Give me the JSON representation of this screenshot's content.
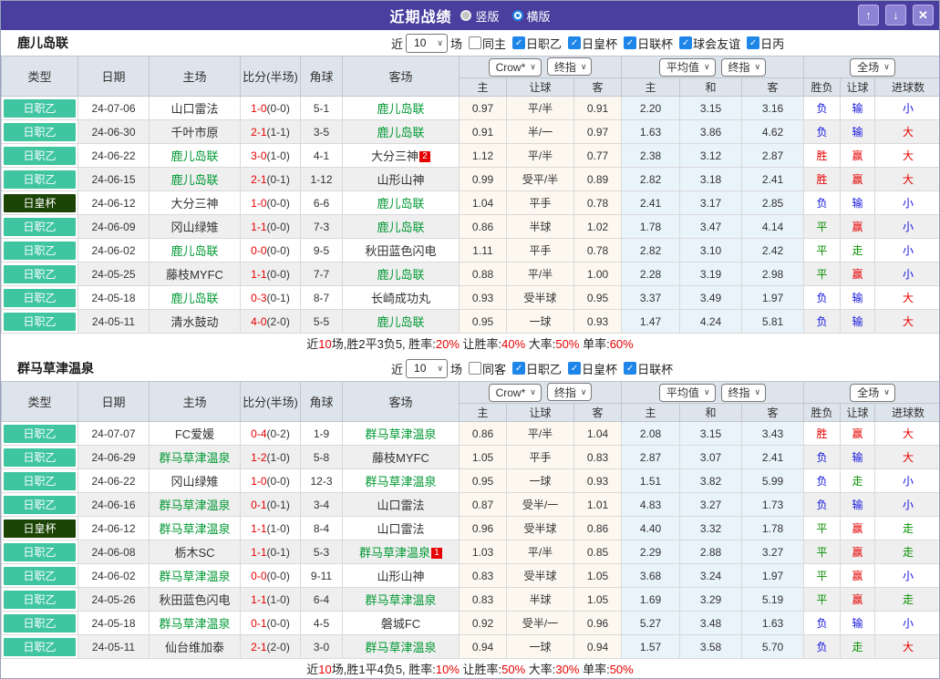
{
  "titlebar": {
    "title": "近期战绩",
    "radio_vertical": {
      "label": "竖版",
      "selected": false
    },
    "radio_horizontal": {
      "label": "横版",
      "selected": true
    },
    "up_icon": "↑",
    "down_icon": "↓",
    "close_icon": "✕"
  },
  "filter_labels": {
    "near": "近",
    "matches": "场",
    "count": "10"
  },
  "table_header": {
    "static_cols": [
      "类型",
      "日期",
      "主场",
      "比分(半场)",
      "角球",
      "客场"
    ],
    "dropdowns": {
      "bookmaker": "Crow*",
      "bookmaker_mode": "终指",
      "average": "平均值",
      "average_mode": "终指",
      "scope": "全场"
    },
    "sub_cols": [
      "主",
      "让球",
      "客",
      "主",
      "和",
      "客",
      "胜负",
      "让球",
      "进球数"
    ]
  },
  "sections": [
    {
      "team": "鹿儿岛联",
      "count": "10",
      "same_venue": {
        "label": "同主",
        "checked": false
      },
      "leagues": [
        {
          "label": "日职乙",
          "checked": true
        },
        {
          "label": "日皇杯",
          "checked": true
        },
        {
          "label": "日联杯",
          "checked": true
        },
        {
          "label": "球会友谊",
          "checked": true
        },
        {
          "label": "日丙",
          "checked": true
        }
      ],
      "rows": [
        {
          "type": "日职乙",
          "cup": false,
          "date": "24-07-06",
          "home": "山口雷法",
          "home_green": false,
          "home_badge": "",
          "score": "1-0",
          "half": "(0-0)",
          "corner": "5-1",
          "away": "鹿儿岛联",
          "away_green": true,
          "away_badge": "",
          "crow": [
            "0.97",
            "平/半",
            "0.91"
          ],
          "avg": [
            "2.20",
            "3.15",
            "3.16"
          ],
          "result": [
            [
              "负",
              "blue"
            ],
            [
              "输",
              "blue"
            ],
            [
              "小",
              "blue"
            ]
          ]
        },
        {
          "type": "日职乙",
          "cup": false,
          "date": "24-06-30",
          "home": "千叶市原",
          "home_green": false,
          "home_badge": "",
          "score": "2-1",
          "half": "(1-1)",
          "corner": "3-5",
          "away": "鹿儿岛联",
          "away_green": true,
          "away_badge": "",
          "crow": [
            "0.91",
            "半/一",
            "0.97"
          ],
          "avg": [
            "1.63",
            "3.86",
            "4.62"
          ],
          "result": [
            [
              "负",
              "blue"
            ],
            [
              "输",
              "blue"
            ],
            [
              "大",
              "red"
            ]
          ]
        },
        {
          "type": "日职乙",
          "cup": false,
          "date": "24-06-22",
          "home": "鹿儿岛联",
          "home_green": true,
          "home_badge": "",
          "score": "3-0",
          "half": "(1-0)",
          "corner": "4-1",
          "away": "大分三神",
          "away_green": false,
          "away_badge": "2",
          "crow": [
            "1.12",
            "平/半",
            "0.77"
          ],
          "avg": [
            "2.38",
            "3.12",
            "2.87"
          ],
          "result": [
            [
              "胜",
              "red"
            ],
            [
              "赢",
              "red"
            ],
            [
              "大",
              "red"
            ]
          ]
        },
        {
          "type": "日职乙",
          "cup": false,
          "date": "24-06-15",
          "home": "鹿儿岛联",
          "home_green": true,
          "home_badge": "",
          "score": "2-1",
          "half": "(0-1)",
          "corner": "1-12",
          "away": "山形山神",
          "away_green": false,
          "away_badge": "",
          "crow": [
            "0.99",
            "受平/半",
            "0.89"
          ],
          "avg": [
            "2.82",
            "3.18",
            "2.41"
          ],
          "result": [
            [
              "胜",
              "red"
            ],
            [
              "赢",
              "red"
            ],
            [
              "大",
              "red"
            ]
          ]
        },
        {
          "type": "日皇杯",
          "cup": true,
          "date": "24-06-12",
          "home": "大分三神",
          "home_green": false,
          "home_badge": "",
          "score": "1-0",
          "half": "(0-0)",
          "corner": "6-6",
          "away": "鹿儿岛联",
          "away_green": true,
          "away_badge": "",
          "crow": [
            "1.04",
            "平手",
            "0.78"
          ],
          "avg": [
            "2.41",
            "3.17",
            "2.85"
          ],
          "result": [
            [
              "负",
              "blue"
            ],
            [
              "输",
              "blue"
            ],
            [
              "小",
              "blue"
            ]
          ]
        },
        {
          "type": "日职乙",
          "cup": false,
          "date": "24-06-09",
          "home": "冈山绿雉",
          "home_green": false,
          "home_badge": "",
          "score": "1-1",
          "half": "(0-0)",
          "corner": "7-3",
          "away": "鹿儿岛联",
          "away_green": true,
          "away_badge": "",
          "crow": [
            "0.86",
            "半球",
            "1.02"
          ],
          "avg": [
            "1.78",
            "3.47",
            "4.14"
          ],
          "result": [
            [
              "平",
              "green"
            ],
            [
              "赢",
              "red"
            ],
            [
              "小",
              "blue"
            ]
          ]
        },
        {
          "type": "日职乙",
          "cup": false,
          "date": "24-06-02",
          "home": "鹿儿岛联",
          "home_green": true,
          "home_badge": "",
          "score": "0-0",
          "half": "(0-0)",
          "corner": "9-5",
          "away": "秋田蓝色闪电",
          "away_green": false,
          "away_badge": "",
          "crow": [
            "1.11",
            "平手",
            "0.78"
          ],
          "avg": [
            "2.82",
            "3.10",
            "2.42"
          ],
          "result": [
            [
              "平",
              "green"
            ],
            [
              "走",
              "green"
            ],
            [
              "小",
              "blue"
            ]
          ]
        },
        {
          "type": "日职乙",
          "cup": false,
          "date": "24-05-25",
          "home": "藤枝MYFC",
          "home_green": false,
          "home_badge": "",
          "score": "1-1",
          "half": "(0-0)",
          "corner": "7-7",
          "away": "鹿儿岛联",
          "away_green": true,
          "away_badge": "",
          "crow": [
            "0.88",
            "平/半",
            "1.00"
          ],
          "avg": [
            "2.28",
            "3.19",
            "2.98"
          ],
          "result": [
            [
              "平",
              "green"
            ],
            [
              "赢",
              "red"
            ],
            [
              "小",
              "blue"
            ]
          ]
        },
        {
          "type": "日职乙",
          "cup": false,
          "date": "24-05-18",
          "home": "鹿儿岛联",
          "home_green": true,
          "home_badge": "",
          "score": "0-3",
          "half": "(0-1)",
          "corner": "8-7",
          "away": "长崎成功丸",
          "away_green": false,
          "away_badge": "",
          "crow": [
            "0.93",
            "受半球",
            "0.95"
          ],
          "avg": [
            "3.37",
            "3.49",
            "1.97"
          ],
          "result": [
            [
              "负",
              "blue"
            ],
            [
              "输",
              "blue"
            ],
            [
              "大",
              "red"
            ]
          ]
        },
        {
          "type": "日职乙",
          "cup": false,
          "date": "24-05-11",
          "home": "清水鼓动",
          "home_green": false,
          "home_badge": "",
          "score": "4-0",
          "half": "(2-0)",
          "corner": "5-5",
          "away": "鹿儿岛联",
          "away_green": true,
          "away_badge": "",
          "crow": [
            "0.95",
            "一球",
            "0.93"
          ],
          "avg": [
            "1.47",
            "4.24",
            "5.81"
          ],
          "result": [
            [
              "负",
              "blue"
            ],
            [
              "输",
              "blue"
            ],
            [
              "大",
              "red"
            ]
          ]
        }
      ],
      "summary": [
        [
          "近",
          false
        ],
        [
          "10",
          true
        ],
        [
          "场,胜2平3负5, 胜率:",
          false
        ],
        [
          "20%",
          true
        ],
        [
          " 让胜率:",
          false
        ],
        [
          "40%",
          true
        ],
        [
          " 大率:",
          false
        ],
        [
          "50%",
          true
        ],
        [
          " 单率:",
          false
        ],
        [
          "60%",
          true
        ]
      ]
    },
    {
      "team": "群马草津温泉",
      "count": "10",
      "same_venue": {
        "label": "同客",
        "checked": false
      },
      "leagues": [
        {
          "label": "日职乙",
          "checked": true
        },
        {
          "label": "日皇杯",
          "checked": true
        },
        {
          "label": "日联杯",
          "checked": true
        }
      ],
      "rows": [
        {
          "type": "日职乙",
          "cup": false,
          "date": "24-07-07",
          "home": "FC爱媛",
          "home_green": false,
          "home_badge": "",
          "score": "0-4",
          "half": "(0-2)",
          "corner": "1-9",
          "away": "群马草津温泉",
          "away_green": true,
          "away_badge": "",
          "crow": [
            "0.86",
            "平/半",
            "1.04"
          ],
          "avg": [
            "2.08",
            "3.15",
            "3.43"
          ],
          "result": [
            [
              "胜",
              "red"
            ],
            [
              "赢",
              "red"
            ],
            [
              "大",
              "red"
            ]
          ]
        },
        {
          "type": "日职乙",
          "cup": false,
          "date": "24-06-29",
          "home": "群马草津温泉",
          "home_green": true,
          "home_badge": "",
          "score": "1-2",
          "half": "(1-0)",
          "corner": "5-8",
          "away": "藤枝MYFC",
          "away_green": false,
          "away_badge": "",
          "crow": [
            "1.05",
            "平手",
            "0.83"
          ],
          "avg": [
            "2.87",
            "3.07",
            "2.41"
          ],
          "result": [
            [
              "负",
              "blue"
            ],
            [
              "输",
              "blue"
            ],
            [
              "大",
              "red"
            ]
          ]
        },
        {
          "type": "日职乙",
          "cup": false,
          "date": "24-06-22",
          "home": "冈山绿雉",
          "home_green": false,
          "home_badge": "",
          "score": "1-0",
          "half": "(0-0)",
          "corner": "12-3",
          "away": "群马草津温泉",
          "away_green": true,
          "away_badge": "",
          "crow": [
            "0.95",
            "一球",
            "0.93"
          ],
          "avg": [
            "1.51",
            "3.82",
            "5.99"
          ],
          "result": [
            [
              "负",
              "blue"
            ],
            [
              "走",
              "green"
            ],
            [
              "小",
              "blue"
            ]
          ]
        },
        {
          "type": "日职乙",
          "cup": false,
          "date": "24-06-16",
          "home": "群马草津温泉",
          "home_green": true,
          "home_badge": "",
          "score": "0-1",
          "half": "(0-1)",
          "corner": "3-4",
          "away": "山口雷法",
          "away_green": false,
          "away_badge": "",
          "crow": [
            "0.87",
            "受半/一",
            "1.01"
          ],
          "avg": [
            "4.83",
            "3.27",
            "1.73"
          ],
          "result": [
            [
              "负",
              "blue"
            ],
            [
              "输",
              "blue"
            ],
            [
              "小",
              "blue"
            ]
          ]
        },
        {
          "type": "日皇杯",
          "cup": true,
          "date": "24-06-12",
          "home": "群马草津温泉",
          "home_green": true,
          "home_badge": "",
          "score": "1-1",
          "half": "(1-0)",
          "corner": "8-4",
          "away": "山口雷法",
          "away_green": false,
          "away_badge": "",
          "crow": [
            "0.96",
            "受半球",
            "0.86"
          ],
          "avg": [
            "4.40",
            "3.32",
            "1.78"
          ],
          "result": [
            [
              "平",
              "green"
            ],
            [
              "赢",
              "red"
            ],
            [
              "走",
              "green"
            ]
          ]
        },
        {
          "type": "日职乙",
          "cup": false,
          "date": "24-06-08",
          "home": "栃木SC",
          "home_green": false,
          "home_badge": "",
          "score": "1-1",
          "half": "(0-1)",
          "corner": "5-3",
          "away": "群马草津温泉",
          "away_green": true,
          "away_badge": "1",
          "crow": [
            "1.03",
            "平/半",
            "0.85"
          ],
          "avg": [
            "2.29",
            "2.88",
            "3.27"
          ],
          "result": [
            [
              "平",
              "green"
            ],
            [
              "赢",
              "red"
            ],
            [
              "走",
              "green"
            ]
          ]
        },
        {
          "type": "日职乙",
          "cup": false,
          "date": "24-06-02",
          "home": "群马草津温泉",
          "home_green": true,
          "home_badge": "",
          "score": "0-0",
          "half": "(0-0)",
          "corner": "9-11",
          "away": "山形山神",
          "away_green": false,
          "away_badge": "",
          "crow": [
            "0.83",
            "受半球",
            "1.05"
          ],
          "avg": [
            "3.68",
            "3.24",
            "1.97"
          ],
          "result": [
            [
              "平",
              "green"
            ],
            [
              "赢",
              "red"
            ],
            [
              "小",
              "blue"
            ]
          ]
        },
        {
          "type": "日职乙",
          "cup": false,
          "date": "24-05-26",
          "home": "秋田蓝色闪电",
          "home_green": false,
          "home_badge": "",
          "score": "1-1",
          "half": "(1-0)",
          "corner": "6-4",
          "away": "群马草津温泉",
          "away_green": true,
          "away_badge": "",
          "crow": [
            "0.83",
            "半球",
            "1.05"
          ],
          "avg": [
            "1.69",
            "3.29",
            "5.19"
          ],
          "result": [
            [
              "平",
              "green"
            ],
            [
              "赢",
              "red"
            ],
            [
              "走",
              "green"
            ]
          ]
        },
        {
          "type": "日职乙",
          "cup": false,
          "date": "24-05-18",
          "home": "群马草津温泉",
          "home_green": true,
          "home_badge": "",
          "score": "0-1",
          "half": "(0-0)",
          "corner": "4-5",
          "away": "磐城FC",
          "away_green": false,
          "away_badge": "",
          "crow": [
            "0.92",
            "受半/一",
            "0.96"
          ],
          "avg": [
            "5.27",
            "3.48",
            "1.63"
          ],
          "result": [
            [
              "负",
              "blue"
            ],
            [
              "输",
              "blue"
            ],
            [
              "小",
              "blue"
            ]
          ]
        },
        {
          "type": "日职乙",
          "cup": false,
          "date": "24-05-11",
          "home": "仙台维加泰",
          "home_green": false,
          "home_badge": "",
          "score": "2-1",
          "half": "(2-0)",
          "corner": "3-0",
          "away": "群马草津温泉",
          "away_green": true,
          "away_badge": "",
          "crow": [
            "0.94",
            "一球",
            "0.94"
          ],
          "avg": [
            "1.57",
            "3.58",
            "5.70"
          ],
          "result": [
            [
              "负",
              "blue"
            ],
            [
              "走",
              "green"
            ],
            [
              "大",
              "red"
            ]
          ]
        }
      ],
      "summary": [
        [
          "近",
          false
        ],
        [
          "10",
          true
        ],
        [
          "场,胜1平4负5, 胜率:",
          false
        ],
        [
          "10%",
          true
        ],
        [
          " 让胜率:",
          false
        ],
        [
          "50%",
          true
        ],
        [
          " 大率:",
          false
        ],
        [
          "30%",
          true
        ],
        [
          " 单率:",
          false
        ],
        [
          "50%",
          true
        ]
      ]
    }
  ]
}
